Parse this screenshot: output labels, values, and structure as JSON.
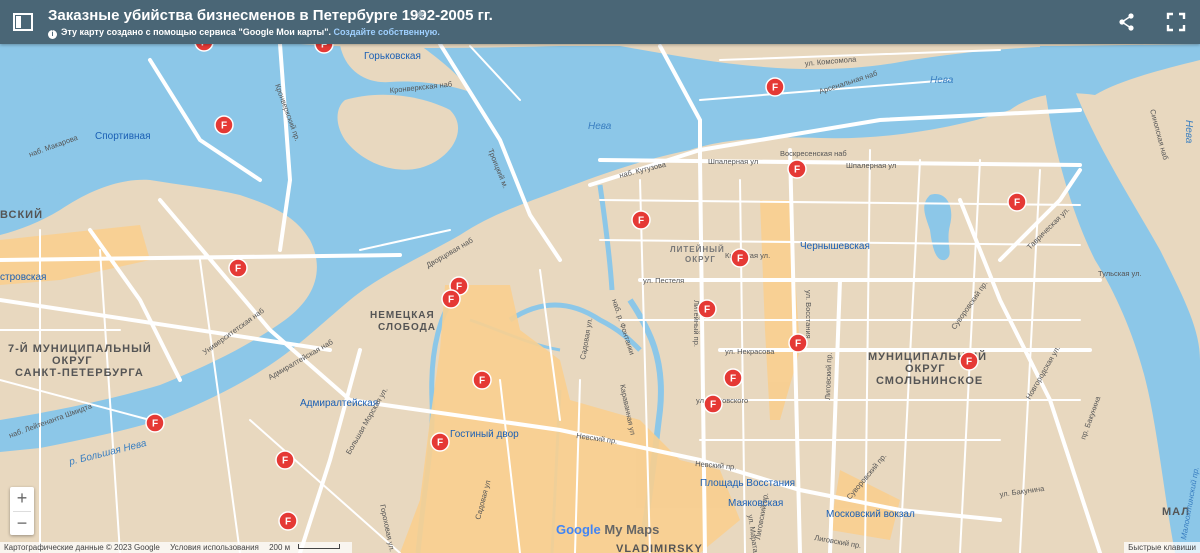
{
  "header": {
    "title": "Заказные убийства бизнесменов в Петербурге 1992-2005 гг.",
    "notice": "Эту карту создано с помощью сервиса \"Google Мои карты\".",
    "notice_link": "Создайте собственную.",
    "info_glyph": "i",
    "star_glyph": "★"
  },
  "zoom": {
    "in": "+",
    "out": "−"
  },
  "attribution": {
    "data": "Картографические данные © 2023 Google",
    "terms": "Условия использования",
    "scale": "200 м",
    "shortcuts": "Быстрые клавиши"
  },
  "branding": {
    "google": "Google",
    "mymaps": "My Maps"
  },
  "colors": {
    "water": "#8cc7e8",
    "land": "#e8d8bf",
    "road": "#ffffff",
    "highlight": "#f9cf8f",
    "marker": "#e53935",
    "header": "#4a6676"
  },
  "map_labels": {
    "districts": [
      "НЕМЕЦКАЯ",
      "СЛОБОДА",
      "ЛИТЕЙНЫЙ",
      "ОКРУГ",
      "МУНИЦИПАЛЬНЫЙ",
      "ОКРУГ",
      "СМОЛЬНИНСКОЕ",
      "7-Й МУНИЦИПАЛЬНЫЙ",
      "ОКРУГ",
      "САНКТ-ПЕТЕРБУРГА",
      "ВСКИЙ",
      "VLADIMIRSKY",
      "МАЛ"
    ],
    "metro": [
      "Горьковская",
      "Спортивная",
      "Чернышевская",
      "Адмиралтейская",
      "Гостиный двор",
      "Площадь Восстания",
      "Маяковская",
      "Московский вокзал",
      "стровская"
    ],
    "water": [
      "Нева",
      "Нева",
      "Нева",
      "р. Большая Нева",
      "Малоохтинский пр."
    ],
    "streets": [
      "ул. Комсомола",
      "Арсенальная наб",
      "Кронверкская наб",
      "Воскресенская наб",
      "Шпалерная ул",
      "Шпалерная ул",
      "наб. Кутузова",
      "Дворцовая наб",
      "ул. Пестеля",
      "Кирочная ул.",
      "ул. Некрасова",
      "Литейный пр.",
      "ул. Восстания",
      "Садовая ул.",
      "Невский пр.",
      "Невский пр.",
      "Университетская наб",
      "Адмиралтейская наб",
      "Большая Морская ул.",
      "Суворовский пр.",
      "Тульская ул.",
      "Синопская наб",
      "Новгородская ул.",
      "Кронверкский пр.",
      "Троицкий м.",
      "Лиговский пр.",
      "ул. Бакунина",
      "Караванная ул",
      "наб. р. Фонтанки",
      "Гороховая ул.",
      "Садовая ул",
      "ул. Марата",
      "ул. Жуковского",
      "Таврическая ул.",
      "наб. Макарова",
      "наб. Лейтенанта Шмидта",
      "Лиговский пр.",
      "Суворовский пр.",
      "Лиговский пр.",
      "пр. Бакунина"
    ]
  },
  "markers": [
    "F",
    "F",
    "F",
    "F",
    "F",
    "F",
    "F",
    "F",
    "F",
    "F",
    "F",
    "F",
    "F",
    "F",
    "F",
    "F",
    "F",
    "F",
    "F",
    "F",
    "F",
    "F",
    "F",
    "F"
  ]
}
